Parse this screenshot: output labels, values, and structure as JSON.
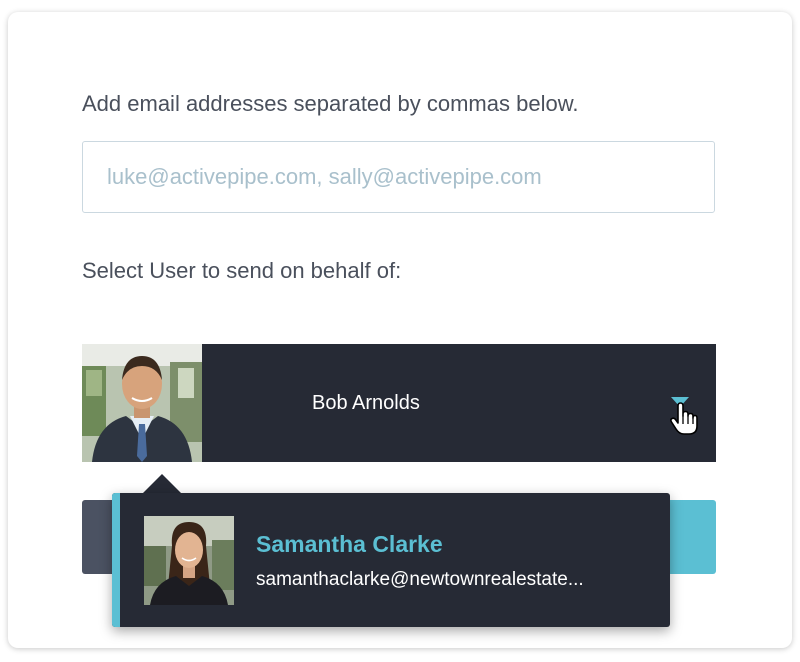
{
  "form": {
    "email_label": "Add email addresses separated by commas below.",
    "email_placeholder": "luke@activepipe.com, sally@activepipe.com",
    "email_value": "",
    "select_label": "Select User to send on behalf of:"
  },
  "user_select": {
    "selected_name": "Bob Arnolds",
    "arrow_icon": "dropdown-triangle-icon",
    "cursor_icon": "hand-pointer-icon"
  },
  "dropdown": {
    "options": [
      {
        "name": "Samantha Clarke",
        "email": "samanthaclarke@newtownrealestate..."
      }
    ]
  },
  "colors": {
    "accent": "#5bbfd3",
    "dark_panel": "#262a35",
    "text": "#4a505c",
    "placeholder": "#a9c0cc",
    "button_left": "#4b5262"
  }
}
